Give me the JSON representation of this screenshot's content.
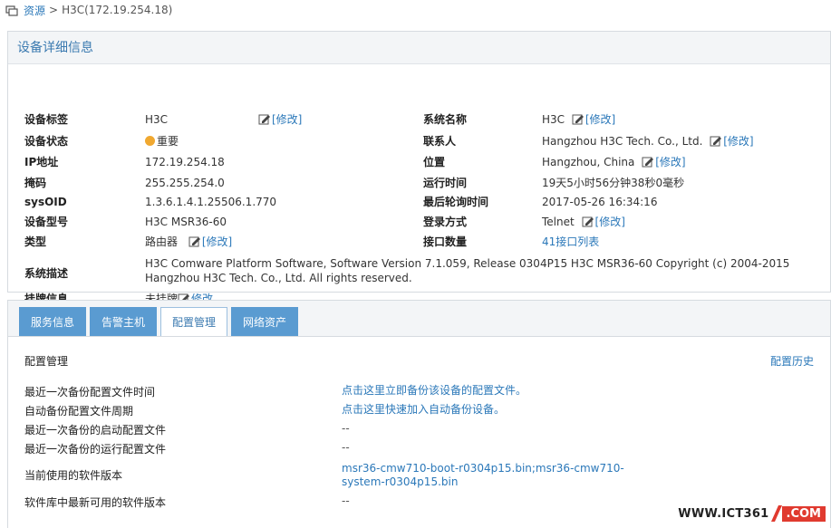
{
  "breadcrumb": {
    "root": "资源",
    "separator": ">",
    "current": "H3C(172.19.254.18)"
  },
  "detail": {
    "title": "设备详细信息",
    "edit_label": "[修改]",
    "left": [
      {
        "label": "设备标签",
        "value": "H3C"
      },
      {
        "label": "设备状态",
        "value": "重要"
      },
      {
        "label": "IP地址",
        "value": "172.19.254.18"
      },
      {
        "label": "掩码",
        "value": "255.255.254.0"
      },
      {
        "label": "sysOID",
        "value": "1.3.6.1.4.1.25506.1.770"
      },
      {
        "label": "设备型号",
        "value": "H3C MSR36-60"
      },
      {
        "label": "类型",
        "value": "路由器"
      }
    ],
    "right": [
      {
        "label": "系统名称",
        "value": "H3C"
      },
      {
        "label": "联系人",
        "value": "Hangzhou H3C Tech. Co., Ltd."
      },
      {
        "label": "位置",
        "value": "Hangzhou, China"
      },
      {
        "label": "运行时间",
        "value": "19天5小时56分钟38秒0毫秒"
      },
      {
        "label": "最后轮询时间",
        "value": "2017-05-26 16:34:16"
      },
      {
        "label": "登录方式",
        "value": "Telnet"
      },
      {
        "label": "接口数量",
        "value": "41",
        "link": "接口列表"
      }
    ],
    "description": {
      "label": "系统描述",
      "value": "H3C Comware Platform Software, Software Version 7.1.059, Release 0304P15 H3C MSR36-60 Copyright (c) 2004-2015 Hangzhou H3C Tech. Co., Ltd. All rights reserved."
    },
    "tag_info": {
      "label": "挂牌信息",
      "value": "未挂牌",
      "edit": "修改"
    }
  },
  "tabs": [
    {
      "label": "服务信息"
    },
    {
      "label": "告警主机"
    },
    {
      "label": "配置管理"
    },
    {
      "label": "网络资产"
    }
  ],
  "config": {
    "title": "配置管理",
    "history_link": "配置历史",
    "rows": [
      {
        "label": "最近一次备份配置文件时间",
        "value": "点击这里立即备份该设备的配置文件。"
      },
      {
        "label": "自动备份配置文件周期",
        "value": "点击这里快速加入自动备份设备。"
      },
      {
        "label": "最近一次备份的启动配置文件",
        "value": "--"
      },
      {
        "label": "最近一次备份的运行配置文件",
        "value": "--"
      },
      {
        "label": "当前使用的软件版本",
        "value": "msr36-cmw710-boot-r0304p15.bin;msr36-cmw710-system-r0304p15.bin"
      },
      {
        "label": "软件库中最新可用的软件版本",
        "value": "--"
      }
    ]
  },
  "watermark": {
    "left": "WWW.ICT361",
    "right": ".COM"
  },
  "colors": {
    "link": "#2b78b9",
    "tab": "#5a9bd1",
    "status_dot": "#f0a830",
    "watermark_red": "#e03a2f"
  }
}
